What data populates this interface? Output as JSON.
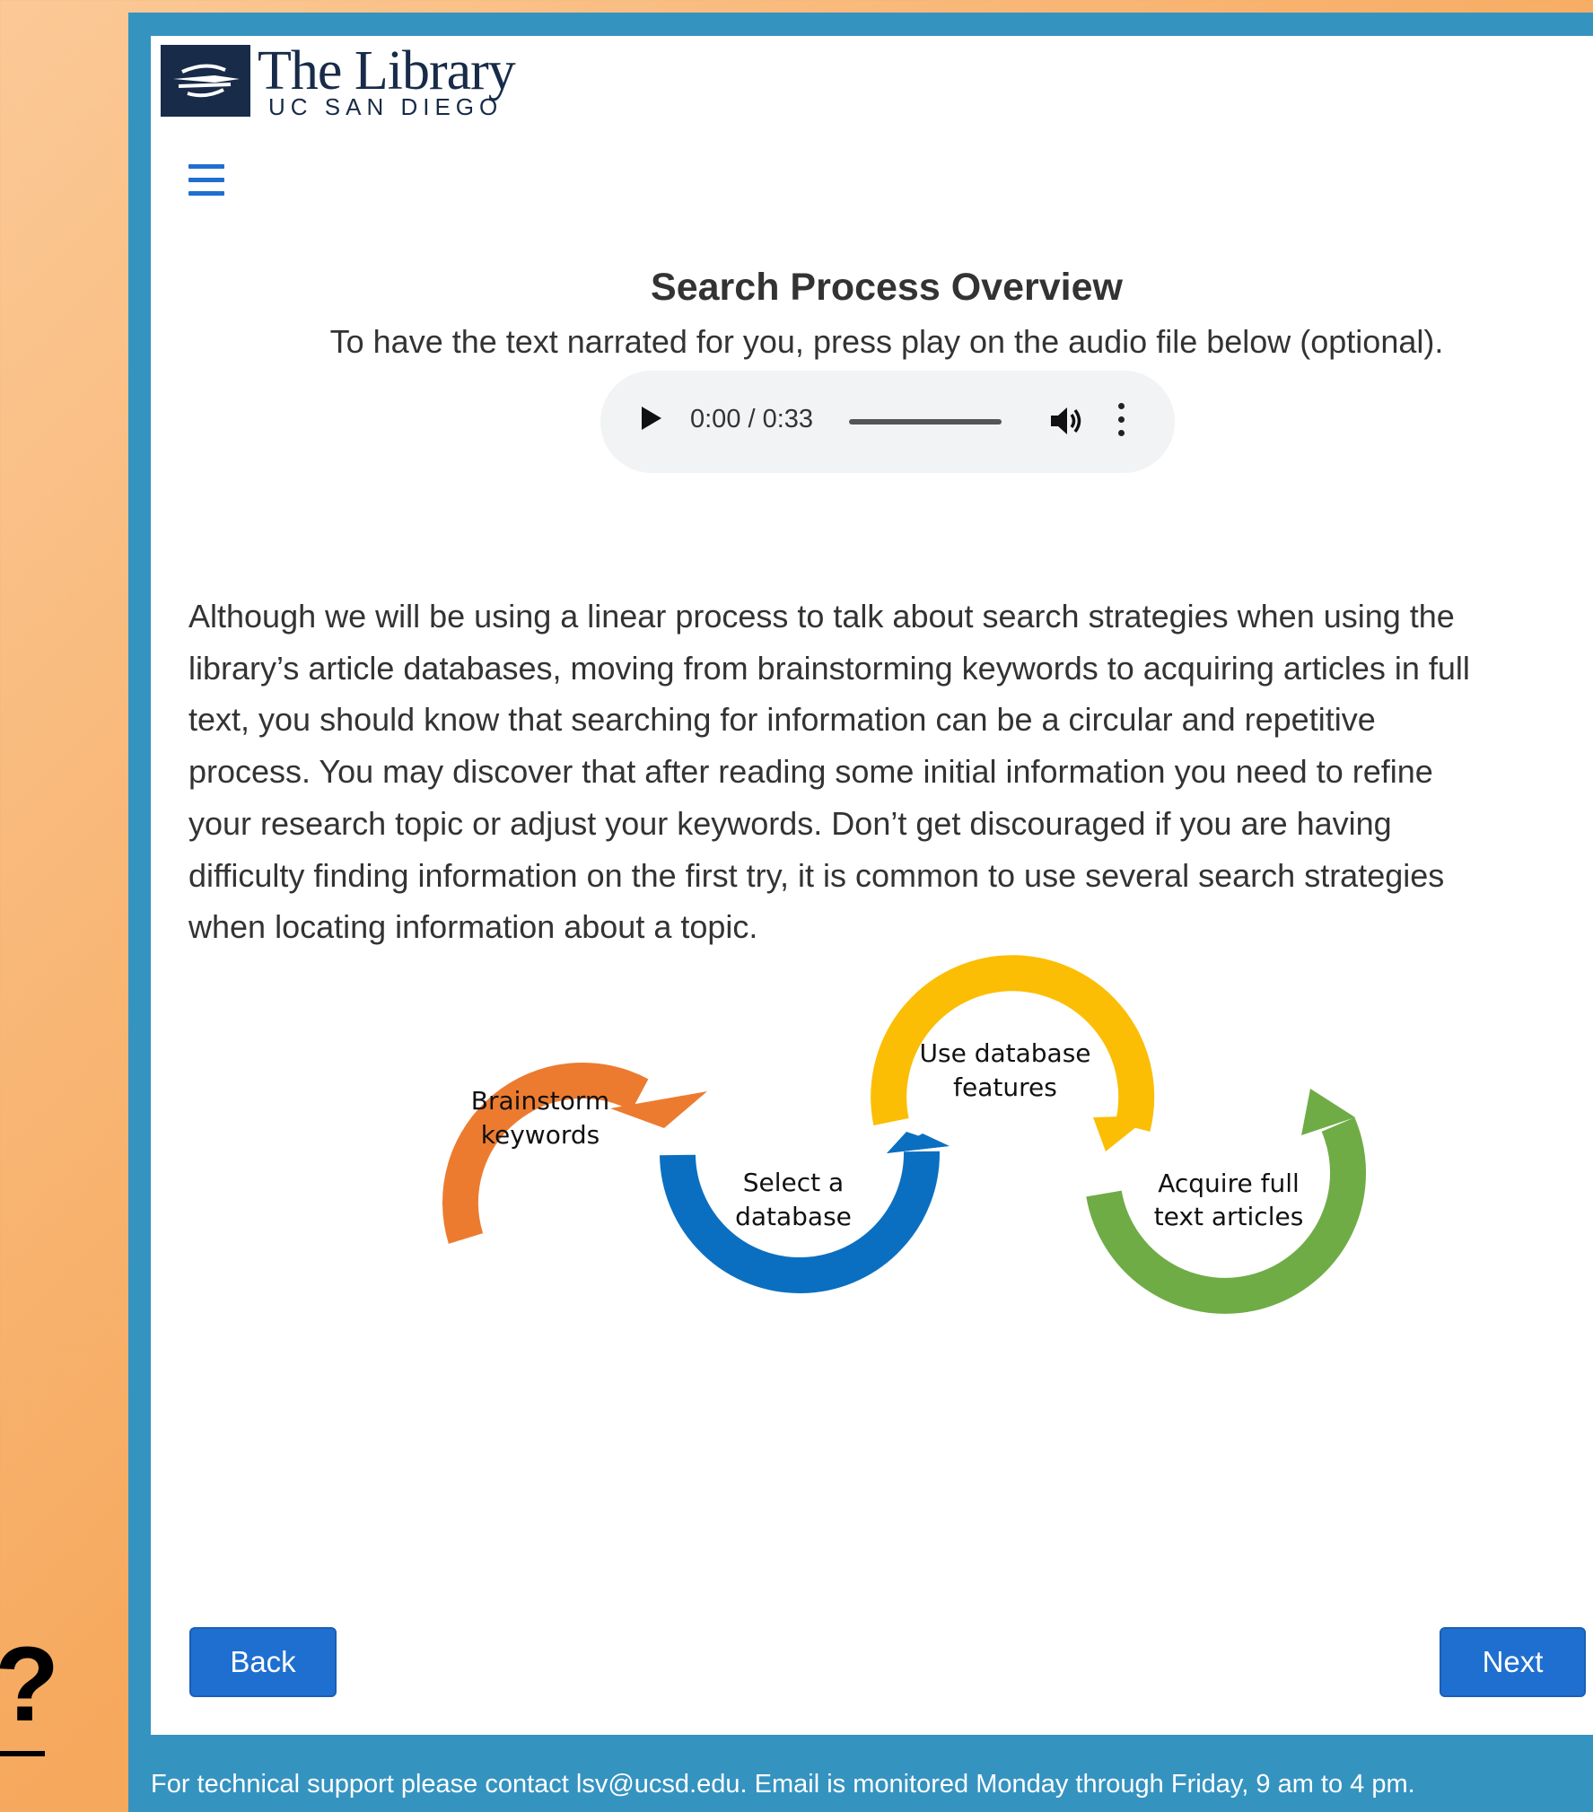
{
  "logo": {
    "title": "The Library",
    "subtitle": "UC SAN DIEGO"
  },
  "page": {
    "title": "Search Process Overview",
    "instruction": "To have the text narrated for you, press play on the audio file below (optional).",
    "body": "Although we will be using a linear process to talk about search strategies when using the\nlibrary’s article databases, moving from brainstorming keywords to acquiring articles in full\ntext, you should know that searching for information can be a circular and repetitive\nprocess.  You may discover that after reading some initial information you need to refine\nyour research topic or adjust your keywords. Don’t get discouraged if you are having\ndifficulty finding information on the first try, it is common to use several search strategies\nwhen locating information about a topic."
  },
  "audio": {
    "time": "0:00 / 0:33"
  },
  "diagram": {
    "steps": [
      {
        "line1": "Brainstorm",
        "line2": "keywords",
        "color": "#ec7b30"
      },
      {
        "line1": "Select a",
        "line2": "database",
        "color": "#0b6fc1"
      },
      {
        "line1": "Use database",
        "line2": "features",
        "color": "#fbbe04"
      },
      {
        "line1": "Acquire full",
        "line2": "text articles",
        "color": "#6fac46"
      }
    ]
  },
  "nav": {
    "back_label": "Back",
    "next_label": "Next"
  },
  "footer": {
    "text": "For technical support please contact lsv@ucsd.edu. Email is monitored Monday through Friday, 9 am to 4 pm."
  },
  "help": {
    "symbol": "?"
  },
  "colors": {
    "frame": "#3593c0",
    "button": "#1f6fd1",
    "navy": "#182b49"
  }
}
